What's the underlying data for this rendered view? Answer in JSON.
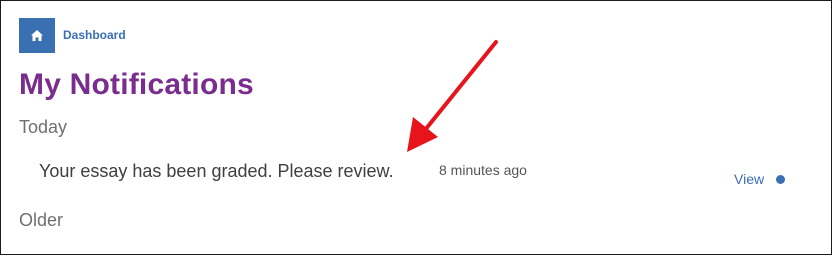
{
  "breadcrumb": {
    "home_icon": "home-icon",
    "label": "Dashboard"
  },
  "page": {
    "title": "My Notifications"
  },
  "groups": [
    {
      "label": "Today",
      "notifications": [
        {
          "message": "Your essay has been graded. Please review.",
          "time": "8 minutes ago",
          "action_label": "View",
          "unread": true
        }
      ]
    },
    {
      "label": "Older",
      "notifications": []
    }
  ],
  "annotation": {
    "icon": "red-arrow-icon",
    "color": "#e8141b"
  },
  "colors": {
    "accent": "#3a6fb2",
    "title": "#7b2d8e"
  }
}
